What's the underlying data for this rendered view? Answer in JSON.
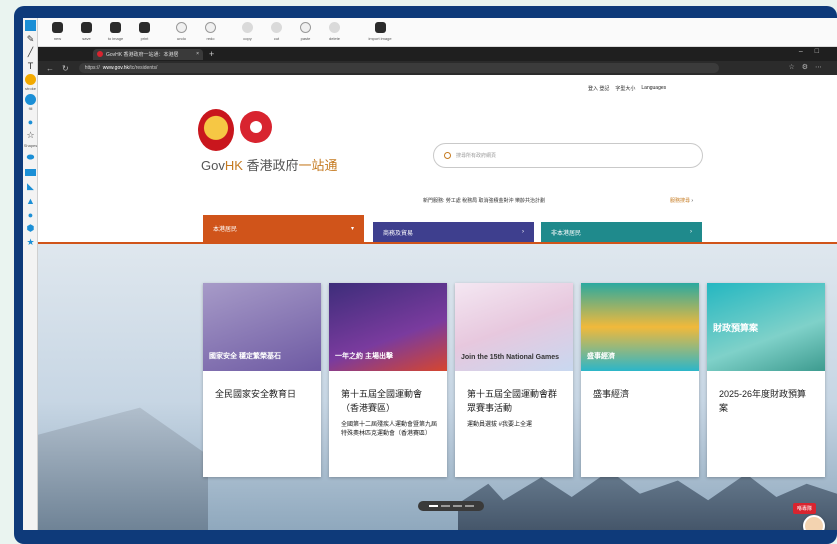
{
  "toolbar": {
    "tools": [
      {
        "label": "new",
        "icon": "new-file-icon"
      },
      {
        "label": "save",
        "icon": "save-icon"
      },
      {
        "label": "to image",
        "icon": "to-image-icon"
      },
      {
        "label": "print",
        "icon": "print-icon"
      },
      {
        "label": "undo",
        "icon": "undo-icon"
      },
      {
        "label": "redo",
        "icon": "redo-icon"
      },
      {
        "label": "copy",
        "icon": "copy-icon"
      },
      {
        "label": "cut",
        "icon": "cut-icon"
      },
      {
        "label": "paste",
        "icon": "paste-icon"
      },
      {
        "label": "delete",
        "icon": "delete-icon"
      },
      {
        "label": "import image",
        "icon": "import-image-icon"
      }
    ]
  },
  "sidebar": {
    "stroke_label": "stroke",
    "fill_label": "fill",
    "shapes_label": "Shapes",
    "stroke_color": "#f2a900",
    "fill_color": "#1b8fd6"
  },
  "browser": {
    "tab_title": "GovHK 香港政府一站通：本港居",
    "url_prefix": "https://",
    "url_host": "www.gov.hk",
    "url_path": "/tc/residents/"
  },
  "page": {
    "util": {
      "signin": "登入 登記",
      "font_size": "字型大小",
      "languages": "Languages"
    },
    "logo": {
      "prefix": "Gov",
      "hk": "HK",
      "middle": " 香港政府",
      "suffix": "一站通"
    },
    "search_placeholder": "搜尋所有政府網頁",
    "quick_links": "新門服務:   勞工處   稅務局   取消強積金對沖   樂齡共治計劃",
    "more_label": "服務搜尋",
    "nav": {
      "residents": "本港居民",
      "business": "商務及貿易",
      "non_residents": "非本港居民"
    },
    "cards": [
      {
        "img_text": "國家安全 穩定繁榮基石",
        "title": "全民國家安全教育日",
        "sub": ""
      },
      {
        "img_text": "一年之約 主場出擊",
        "title": "第十五屆全國運動會（香港賽區）",
        "sub": "全國第十二屆殘疾人運動會暨第九屆特殊奧林匹克運動會（香港賽區）"
      },
      {
        "img_text": "Join the 15th National Games",
        "title": "第十五屆全國運動會群眾賽事活動",
        "sub": "運動員選拔   #我要上全運"
      },
      {
        "img_text": "盛事經濟",
        "title": "盛事經濟",
        "sub": ""
      },
      {
        "img_text": "財政預算案",
        "title": "2025-26年度財政預算案",
        "sub": ""
      }
    ],
    "assistant_label": "喺專隊"
  }
}
